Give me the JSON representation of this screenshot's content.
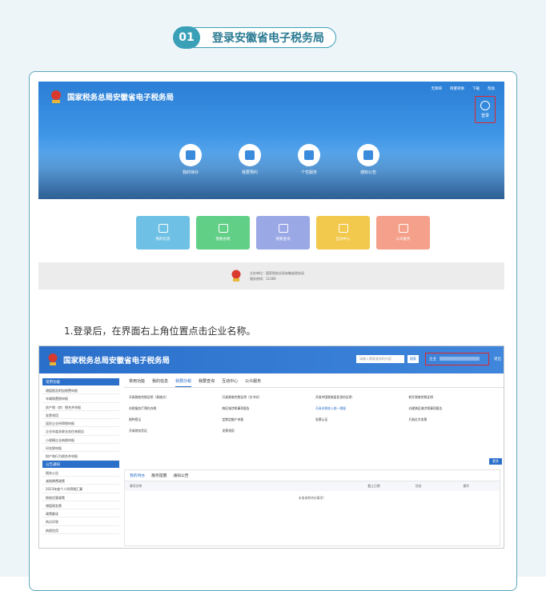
{
  "step": {
    "number": "01",
    "title": "登录安徽省电子税务局"
  },
  "shot1": {
    "site_title": "国家税务总局安徽省电子税务局",
    "top_links": [
      "无障碍",
      "简繁转换",
      "下载",
      "帮助"
    ],
    "login_label": "登录",
    "circles": [
      "我的待办",
      "我要预约",
      "个性服务",
      "通知公告"
    ],
    "tiles": [
      {
        "label": "我的信息",
        "color": "#6ec1e4"
      },
      {
        "label": "我要办税",
        "color": "#62cf87"
      },
      {
        "label": "我要查询",
        "color": "#9aa8e6"
      },
      {
        "label": "互动中心",
        "color": "#f2c94c"
      },
      {
        "label": "公众服务",
        "color": "#f4a08a"
      }
    ],
    "footer_lines": [
      "主办单位：国家税务总局安徽省税务局",
      "服务热线：12366"
    ]
  },
  "instruction": "1.登录后，在界面右上角位置点击企业名称。",
  "shot2": {
    "site_title": "国家税务总局安徽省电子税务局",
    "search_placeholder": "请输入需要查询的内容",
    "search_button": "搜索",
    "company_label": "企业",
    "exit": "退出",
    "side_head1": "常用功能",
    "side_items1": [
      "增值税及附加税费申报",
      "车辆购置税申报",
      "房产税（房）税合并申报",
      "发票领用",
      "居民企业所得税申报",
      "企业年度关联业务往来报告",
      "小规模企业纳税申报",
      "印花税申报",
      "财产和行为税合并申报"
    ],
    "side_head2": "公告通知",
    "side_items2": [
      "税务公告",
      "减税降费政策",
      "2023年度个人所得税汇算",
      "税收优惠政策",
      "增值税发票",
      "政策解读",
      "热点问答",
      "纳税信用"
    ],
    "tabs": [
      "常用功能",
      "我的信息",
      "我要办税",
      "我要查询",
      "互动中心",
      "公众服务"
    ],
    "active_tab": "我要办税",
    "links": [
      "开具税收完税证明（表格式）",
      "开具税收完税证明（文书式）",
      "开具中国税收居民身份证明",
      "转开税收完税证明",
      "办税服务厅预约办税",
      "跨区域涉税事项报告",
      "开具非税收入统一票据",
      "办理跨区域涉税事项报告",
      "税种登记",
      "定期定额户申报",
      "发票认证",
      "开具红字发票",
      "开具财务凭证",
      "发票领用",
      "",
      ""
    ],
    "more_button": "更多",
    "todo_tabs": [
      "我的待办",
      "服务提醒",
      "通知公告"
    ],
    "todo_cols": [
      "事项名称",
      "截止日期",
      "状态",
      "操作"
    ],
    "todo_empty": "未查询到待办事项！"
  }
}
